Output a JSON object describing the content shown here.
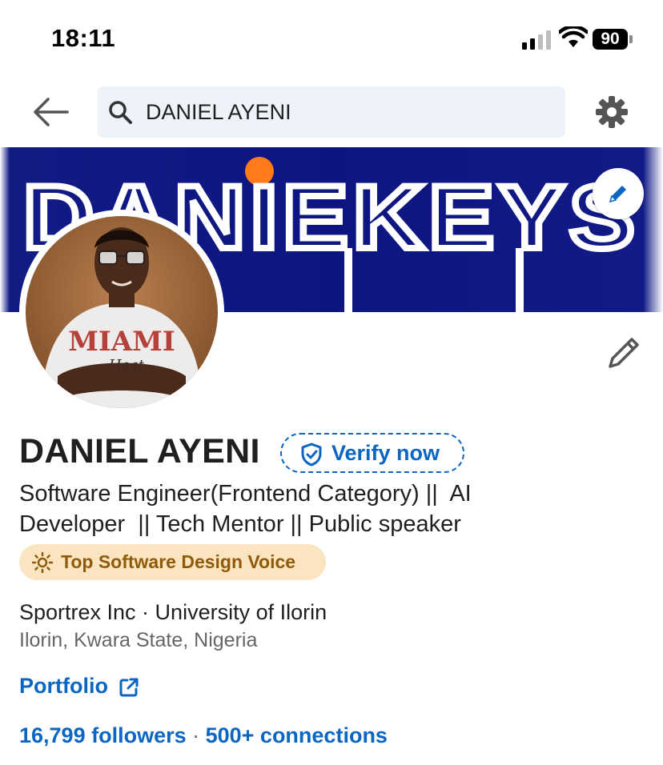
{
  "status_bar": {
    "time": "18:11",
    "battery_level": "90"
  },
  "header": {
    "search_query": "DANIEL AYENI",
    "back_icon": "arrow-left-icon",
    "settings_icon": "gear-icon"
  },
  "banner": {
    "brand_text": "DANIEKEYS",
    "background_color": "#0d1581",
    "dot_color": "#ff7a1a"
  },
  "avatar": {
    "shirt_text": "MIAMI",
    "shirt_script": "Heat"
  },
  "profile": {
    "name": "DANIEL AYENI",
    "verify_label": "Verify now",
    "headline": "Software Engineer(Frontend Category) ||  AI\nDeveloper  || Tech Mentor || Public speaker",
    "voice_badge": "Top Software Design Voice",
    "organizations": "Sportrex Inc · University of Ilorin",
    "location": "Ilorin, Kwara State, Nigeria",
    "portfolio_label": "Portfolio",
    "followers": "16,799 followers",
    "separator": " · ",
    "connections": "500+ connections"
  },
  "colors": {
    "link_blue": "#0a66c2",
    "badge_bg": "#fbe5c0",
    "badge_text": "#8f5a0b",
    "search_bg": "#edf3f8"
  }
}
